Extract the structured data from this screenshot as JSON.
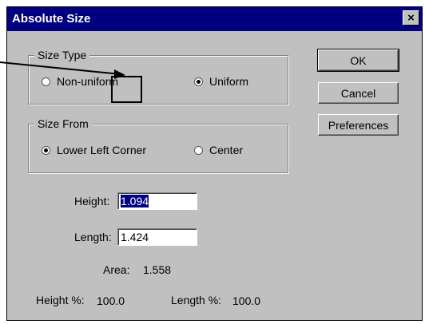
{
  "dialog": {
    "title": "Absolute Size",
    "close_glyph": "×"
  },
  "size_type": {
    "legend": "Size Type",
    "options": [
      {
        "label": "Non-uniform",
        "selected": false
      },
      {
        "label": "Uniform",
        "selected": true
      }
    ]
  },
  "size_from": {
    "legend": "Size From",
    "options": [
      {
        "label": "Lower Left Corner",
        "selected": true
      },
      {
        "label": "Center",
        "selected": false
      }
    ]
  },
  "fields": {
    "height_label": "Height:",
    "height_value": "1.094",
    "length_label": "Length:",
    "length_value": "1.424"
  },
  "info": {
    "area_label": "Area:",
    "area_value": "1.558",
    "height_pct_label": "Height %:",
    "height_pct_value": "100.0",
    "length_pct_label": "Length %:",
    "length_pct_value": "100.0"
  },
  "buttons": {
    "ok": "OK",
    "cancel": "Cancel",
    "preferences": "Preferences"
  },
  "annotation": {
    "color": "#000000"
  }
}
